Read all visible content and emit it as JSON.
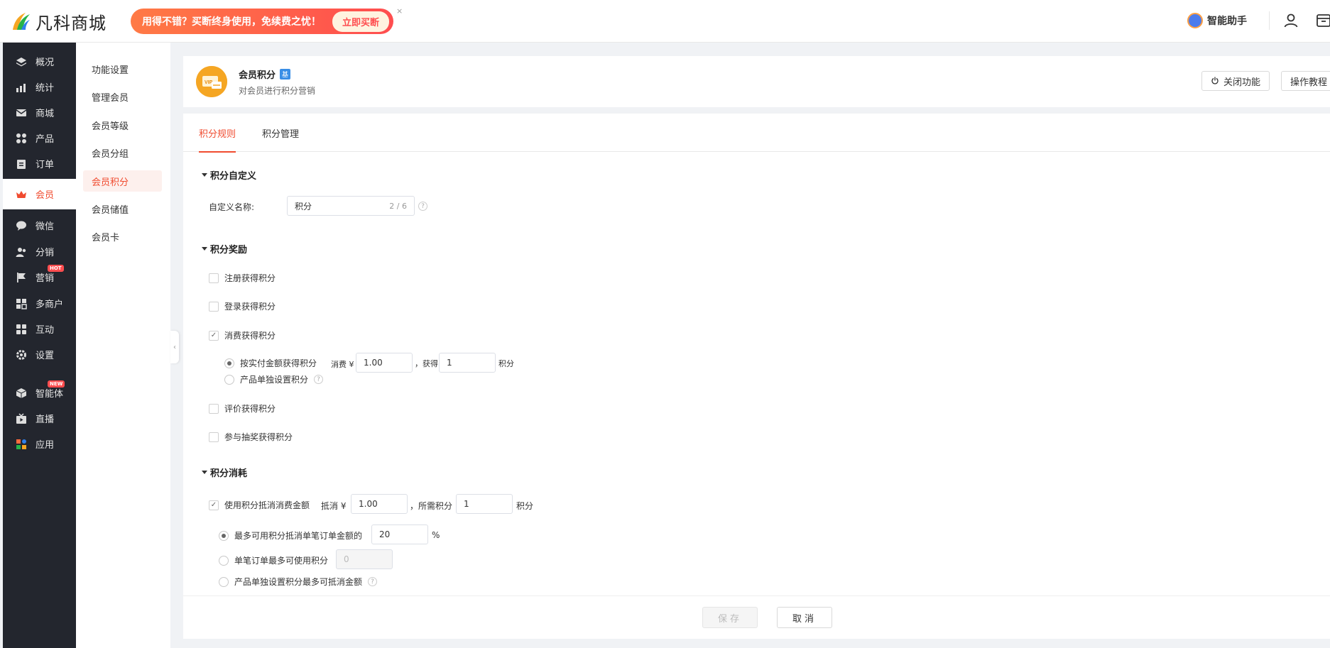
{
  "header": {
    "logo_text": "凡科商城",
    "promo_text": "用得不错？买断终身使用，免续费之忧！",
    "promo_button": "立即买断",
    "promo_close": "×",
    "assistant_label": "智能助手"
  },
  "sidebar": {
    "items": [
      {
        "label": "概况",
        "icon": "layers-icon"
      },
      {
        "label": "统计",
        "icon": "chart-icon"
      },
      {
        "label": "商城",
        "icon": "mail-icon"
      },
      {
        "label": "产品",
        "icon": "grid-icon"
      },
      {
        "label": "订单",
        "icon": "clipboard-icon"
      },
      {
        "label": "会员",
        "icon": "crown-icon",
        "active": true
      },
      {
        "label": "微信",
        "icon": "wechat-icon"
      },
      {
        "label": "分销",
        "icon": "users-icon"
      },
      {
        "label": "营销",
        "icon": "flag-icon",
        "badge": "HOT"
      },
      {
        "label": "多商户",
        "icon": "store-icon"
      },
      {
        "label": "互动",
        "icon": "interact-icon"
      },
      {
        "label": "设置",
        "icon": "gear-icon"
      },
      {
        "label": "智能体",
        "icon": "cube-icon",
        "badge": "NEW"
      },
      {
        "label": "直播",
        "icon": "tv-icon"
      },
      {
        "label": "应用",
        "icon": "apps-icon"
      }
    ],
    "active_color": "#f04b2f"
  },
  "subnav": {
    "items": [
      "功能设置",
      "管理会员",
      "会员等级",
      "会员分组",
      "会员积分",
      "会员储值",
      "会员卡"
    ],
    "active_index": 4
  },
  "module": {
    "title": "会员积分",
    "tag": "基",
    "desc": "对会员进行积分营销",
    "btn_close": "关闭功能",
    "btn_tutorial": "操作教程"
  },
  "tabs": [
    "积分规则",
    "积分管理"
  ],
  "custom": {
    "section": "积分自定义",
    "label": "自定义名称:",
    "value": "积分",
    "count": "2 / 6",
    "help": "?"
  },
  "reward": {
    "section": "积分奖励",
    "register": "注册获得积分",
    "login": "登录获得积分",
    "consume": "消费获得积分",
    "by_amount": "按实付金额获得积分",
    "spend_label": "消费 ¥",
    "spend_value": "1.00",
    "comma_get": "，获得",
    "get_value": "1",
    "points_unit": "积分",
    "per_product": "产品单独设置积分",
    "review": "评价获得积分",
    "lottery": "参与抽奖获得积分"
  },
  "consume": {
    "section": "积分消耗",
    "use_points": "使用积分抵消消费金额",
    "offset_label": "抵消 ¥",
    "offset_value": "1.00",
    "comma_required": "，所需积分",
    "required_value": "1",
    "points_unit": "积分",
    "max_percent_label": "最多可用积分抵消单笔订单金额的",
    "max_percent_value": "20",
    "percent_sign": "%",
    "max_points_label": "单笔订单最多可使用积分",
    "max_points_value": "0",
    "per_product_label": "产品单独设置积分最多可抵消金额"
  },
  "footer": {
    "save": "保存",
    "cancel": "取消"
  }
}
